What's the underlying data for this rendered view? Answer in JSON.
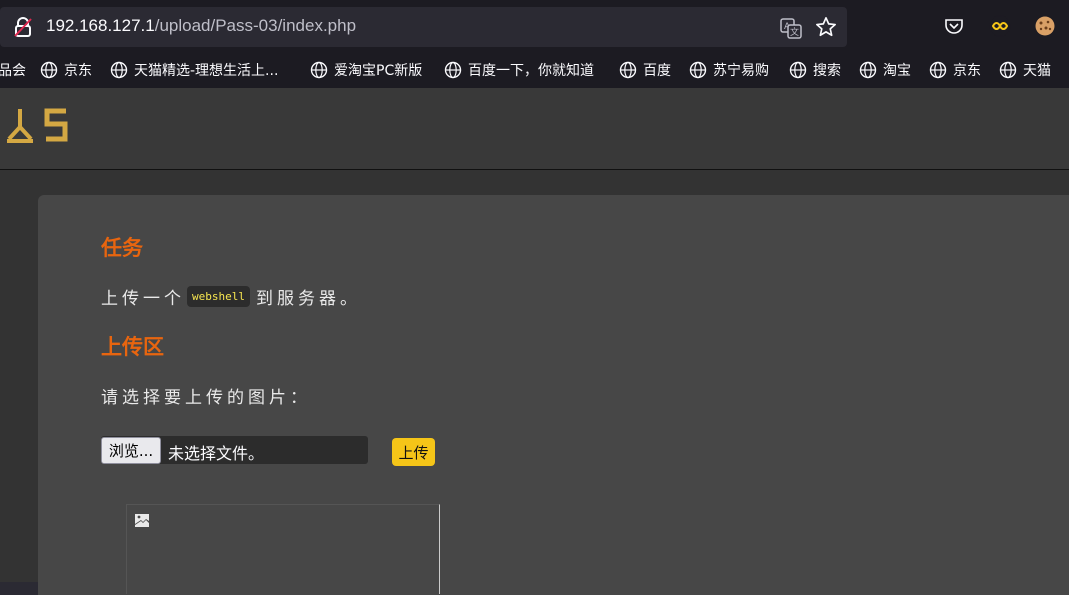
{
  "browser": {
    "url_host": "192.168.127.1",
    "url_path": "/upload/Pass-03/index.php",
    "icons": [
      "lock-icon",
      "translate-icon",
      "star-icon",
      "pocket-icon",
      "extension-icon",
      "cookie-icon"
    ]
  },
  "bookmarks": [
    {
      "label": "品会",
      "icon": null
    },
    {
      "label": "京东",
      "icon": "globe-icon"
    },
    {
      "label": "天猫精选-理想生活上...",
      "icon": "globe-icon"
    },
    {
      "label": "爱淘宝PC新版",
      "icon": "globe-icon"
    },
    {
      "label": "百度一下，你就知道",
      "icon": "globe-icon"
    },
    {
      "label": "百度",
      "icon": "globe-icon"
    },
    {
      "label": "苏宁易购",
      "icon": "globe-icon"
    },
    {
      "label": "搜索",
      "icon": "globe-icon"
    },
    {
      "label": "淘宝",
      "icon": "globe-icon"
    },
    {
      "label": "京东",
      "icon": "globe-icon"
    },
    {
      "label": "天猫",
      "icon": "globe-icon"
    }
  ],
  "page": {
    "task_heading": "任务",
    "task_prefix": "上传一个",
    "task_code": "webshell",
    "task_suffix": "到服务器。",
    "upload_heading": "上传区",
    "select_label": "请选择要上传的图片：",
    "browse_label": "浏览...",
    "no_file_label": "未选择文件。",
    "upload_button": "上传"
  },
  "colors": {
    "accent_heading": "#e8650f",
    "upload_button": "#f5c518",
    "code_text": "#f7e650"
  }
}
